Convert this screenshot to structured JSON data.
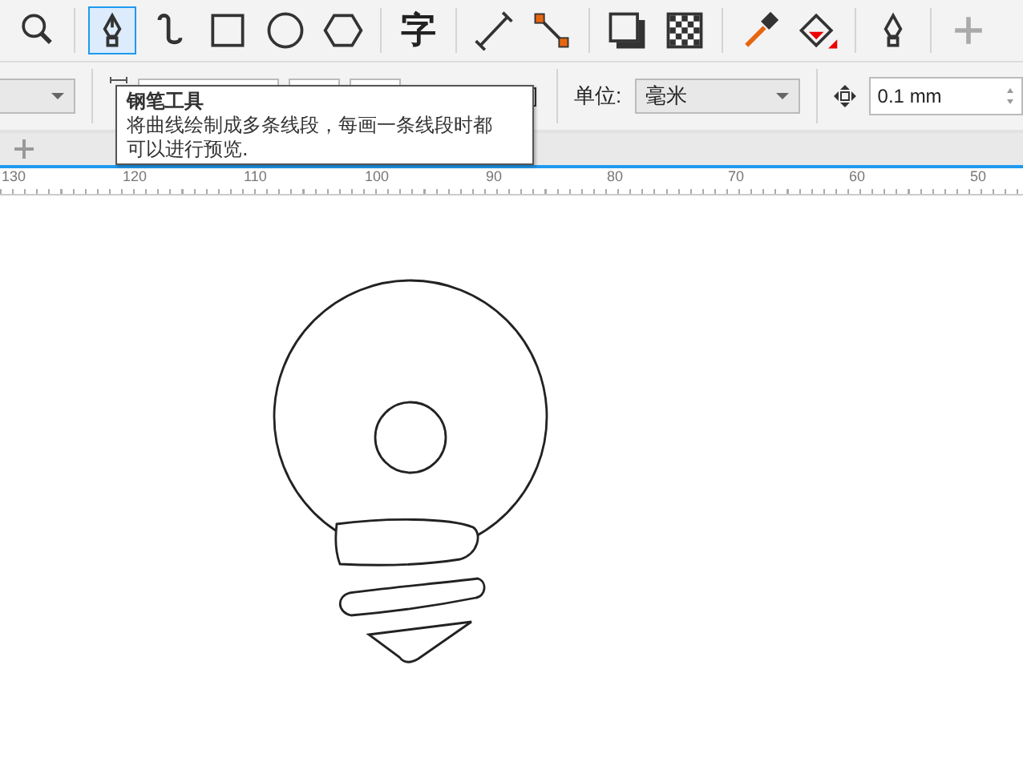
{
  "toolbar": {
    "tools": [
      {
        "kind": "zoom",
        "selected": false
      },
      {
        "kind": "pen",
        "selected": true
      },
      {
        "kind": "curve",
        "selected": false
      },
      {
        "kind": "rect",
        "selected": false
      },
      {
        "kind": "ellipse",
        "selected": false
      },
      {
        "kind": "polygon",
        "selected": false
      },
      {
        "kind": "text",
        "label": "字",
        "selected": false
      },
      {
        "kind": "dimension",
        "selected": false
      },
      {
        "kind": "connector",
        "selected": false
      },
      {
        "kind": "shadow",
        "selected": false
      },
      {
        "kind": "transparency",
        "selected": false
      },
      {
        "kind": "eyedropper",
        "selected": false
      },
      {
        "kind": "fill",
        "selected": false
      },
      {
        "kind": "outline",
        "selected": false
      },
      {
        "kind": "add",
        "selected": false
      }
    ]
  },
  "property_bar": {
    "unit_label": "单位:",
    "unit_value": "毫米",
    "nudge_value": "0.1 mm"
  },
  "tooltip": {
    "title": "钢笔工具",
    "text": "将曲线绘制成多条线段，每画一条线段时都可以进行预览."
  },
  "ruler": {
    "labels": [
      "130",
      "120",
      "110",
      "100",
      "90",
      "80",
      "70",
      "60",
      "50"
    ]
  }
}
